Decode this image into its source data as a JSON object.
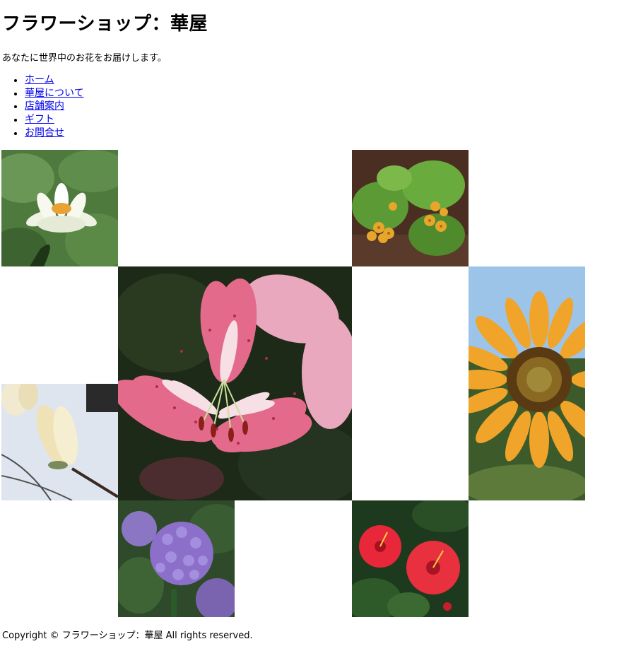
{
  "header": {
    "title": "フラワーショップ：華屋",
    "tagline": "あなたに世界中のお花をお届けします。"
  },
  "nav": {
    "items": [
      {
        "label": "ホーム"
      },
      {
        "label": "華屋について"
      },
      {
        "label": "店舗案内"
      },
      {
        "label": "ギフト"
      },
      {
        "label": "お問合せ"
      }
    ]
  },
  "gallery": {
    "photos": [
      {
        "subject": "water lily",
        "icon": "water-lily-photo"
      },
      {
        "subject": "yellow primrose",
        "icon": "primrose-photo"
      },
      {
        "subject": "pink lily",
        "icon": "lily-photo"
      },
      {
        "subject": "sunflower",
        "icon": "sunflower-photo"
      },
      {
        "subject": "magnolia",
        "icon": "magnolia-photo"
      },
      {
        "subject": "hydrangea",
        "icon": "hydrangea-photo"
      },
      {
        "subject": "hibiscus",
        "icon": "hibiscus-photo"
      }
    ]
  },
  "footer": {
    "copyright": "Copyright © フラワーショップ：華屋 All rights reserved."
  },
  "colors": {
    "link": "#0000ee",
    "text": "#000000",
    "background": "#ffffff"
  }
}
